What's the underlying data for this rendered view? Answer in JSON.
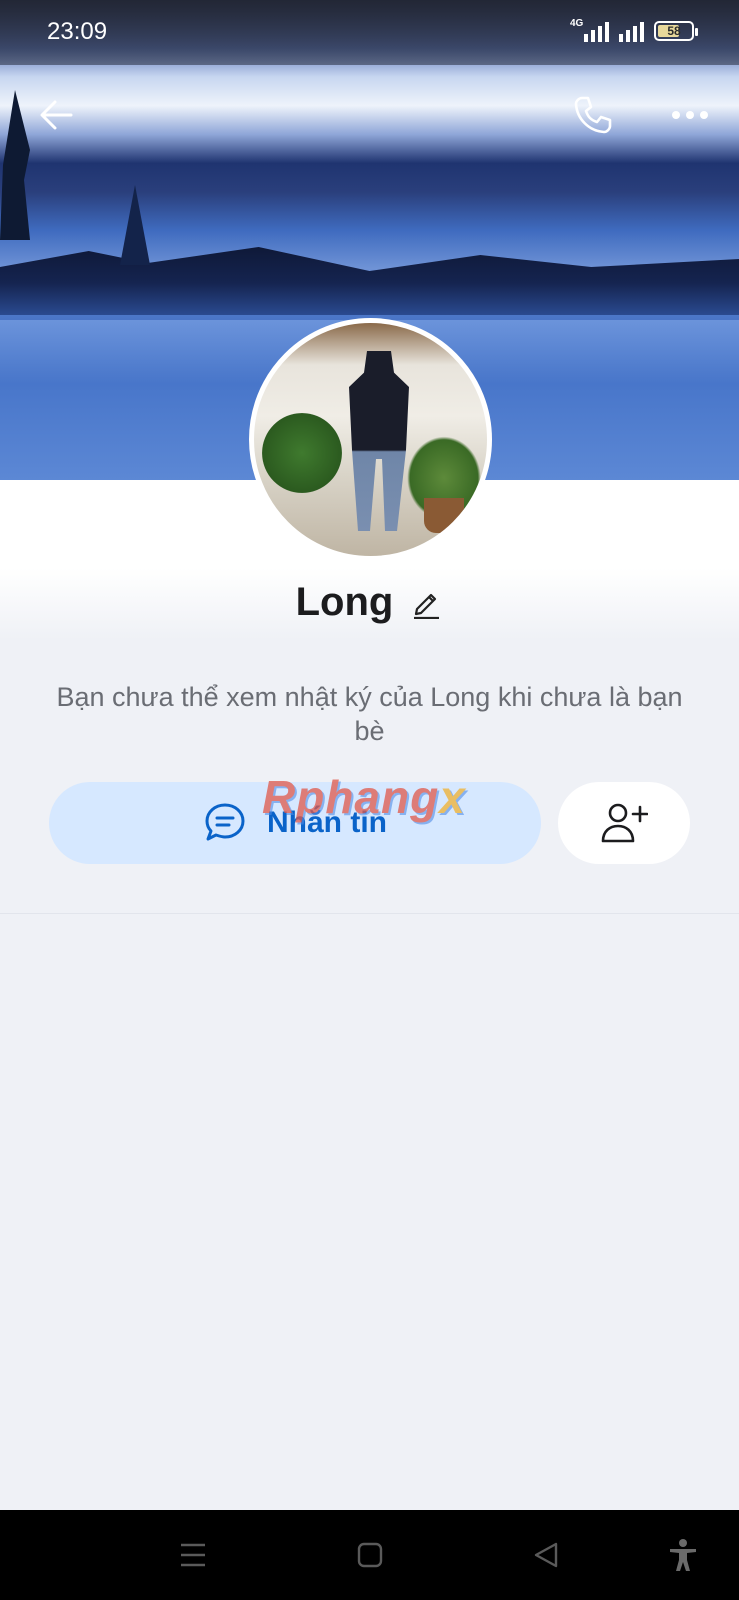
{
  "status_bar": {
    "time": "23:09",
    "network_tag": "4G",
    "battery_level": "58",
    "icons": [
      "signal-4g-icon",
      "signal-icon",
      "battery-icon"
    ]
  },
  "header": {
    "back_icon": "arrow-left-icon",
    "call_icon": "phone-icon",
    "more_icon": "more-horizontal-icon"
  },
  "profile": {
    "name": "Long",
    "edit_icon": "pencil-icon",
    "notice": "Bạn chưa thể xem nhật ký của Long khi chưa là bạn bè"
  },
  "actions": {
    "message_label": "Nhắn tin",
    "message_icon": "chat-bubble-icon",
    "add_friend_icon": "add-user-icon"
  },
  "watermark": {
    "text_main": "Rphang",
    "text_tail": "x"
  },
  "nav_bar": {
    "items": [
      "menu-icon",
      "home-square-icon",
      "back-triangle-icon",
      "accessibility-icon"
    ]
  },
  "colors": {
    "accent": "#0a63c9",
    "message_button_bg": "#d6e8ff",
    "page_bg": "#eff1f6"
  }
}
